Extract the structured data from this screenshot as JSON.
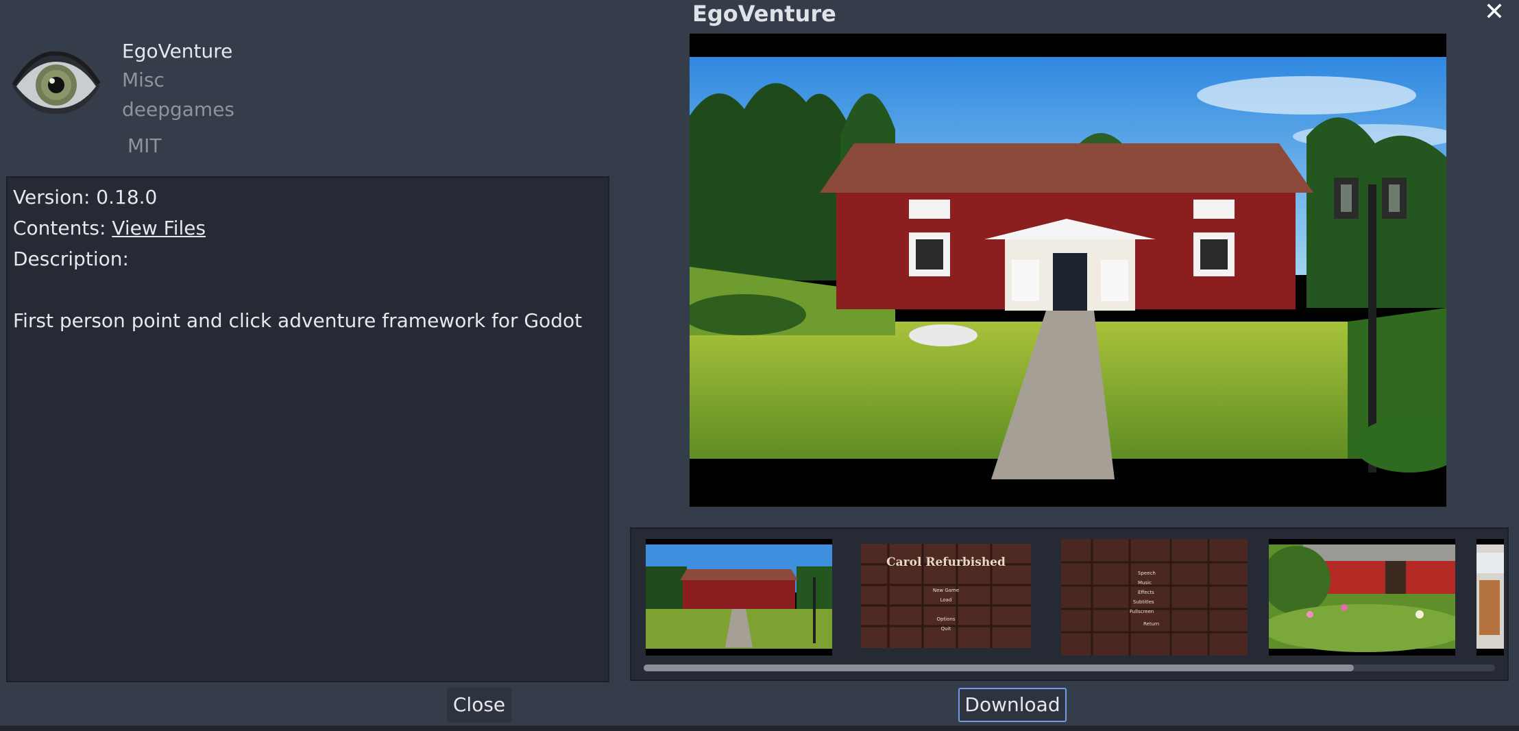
{
  "window": {
    "title": "EgoVenture",
    "close_icon": "close-icon"
  },
  "asset": {
    "name": "EgoVenture",
    "category": "Misc",
    "author": "deepgames",
    "license": "MIT",
    "icon": "eye-icon"
  },
  "details": {
    "version_label": "Version: 0.18.0",
    "contents_label": "Contents: ",
    "contents_link": "View Files",
    "description_label": "Description:",
    "description_text": "First person point and click adventure framework for Godot"
  },
  "thumbnails": {
    "items": [
      {
        "name": "red house screenshot"
      },
      {
        "name": "Carol Refurbished",
        "menu": [
          "New Game",
          "Load",
          "Options",
          "Quit"
        ]
      },
      {
        "name": "options menu",
        "menu": [
          "Speech",
          "Music",
          "Effects",
          "Subtitles",
          "Fullscreen",
          "Return"
        ]
      },
      {
        "name": "red barn garden"
      },
      {
        "name": "partial thumbnail"
      }
    ],
    "scroll_fraction": 0.83
  },
  "buttons": {
    "close_label": "Close",
    "download_label": "Download"
  },
  "colors": {
    "background": "#363d4a",
    "panel": "#252a35",
    "accent_border": "#6f9ce8"
  }
}
